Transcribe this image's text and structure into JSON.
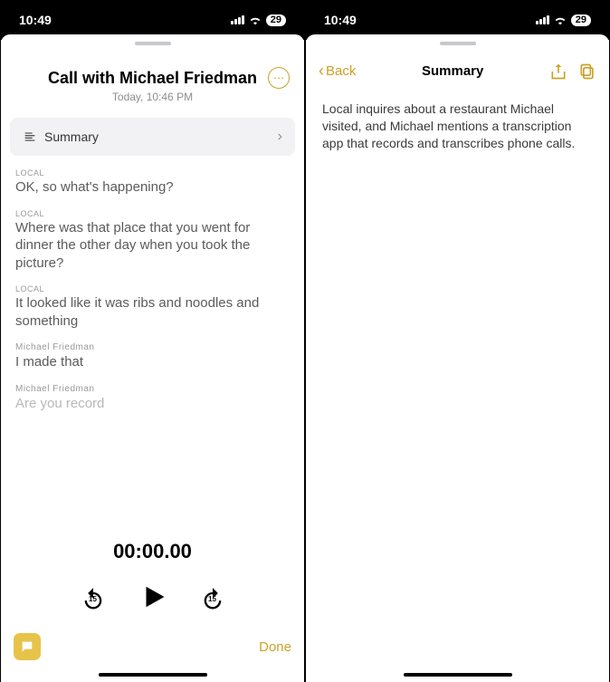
{
  "status": {
    "time": "10:49",
    "battery": "29"
  },
  "left": {
    "title": "Call with Michael Friedman",
    "subtitle": "Today, 10:46 PM",
    "summary_row_label": "Summary",
    "transcript": [
      {
        "speaker": "LOCAL",
        "text": "OK, so what's happening?"
      },
      {
        "speaker": "LOCAL",
        "text": "Where was that place that you went for dinner the other day when you took the picture?"
      },
      {
        "speaker": "LOCAL",
        "text": "It looked like it was ribs and noodles and something"
      },
      {
        "speaker": "Michael Friedman",
        "text": "I made that"
      },
      {
        "speaker": "Michael Friedman",
        "text": "Are you record"
      }
    ],
    "player": {
      "time": "00:00.00",
      "skip_seconds": "15"
    },
    "done_label": "Done"
  },
  "right": {
    "back_label": "Back",
    "nav_title": "Summary",
    "body": "Local inquires about a restaurant Michael visited, and Michael mentions a transcription app that records and transcribes phone calls."
  }
}
